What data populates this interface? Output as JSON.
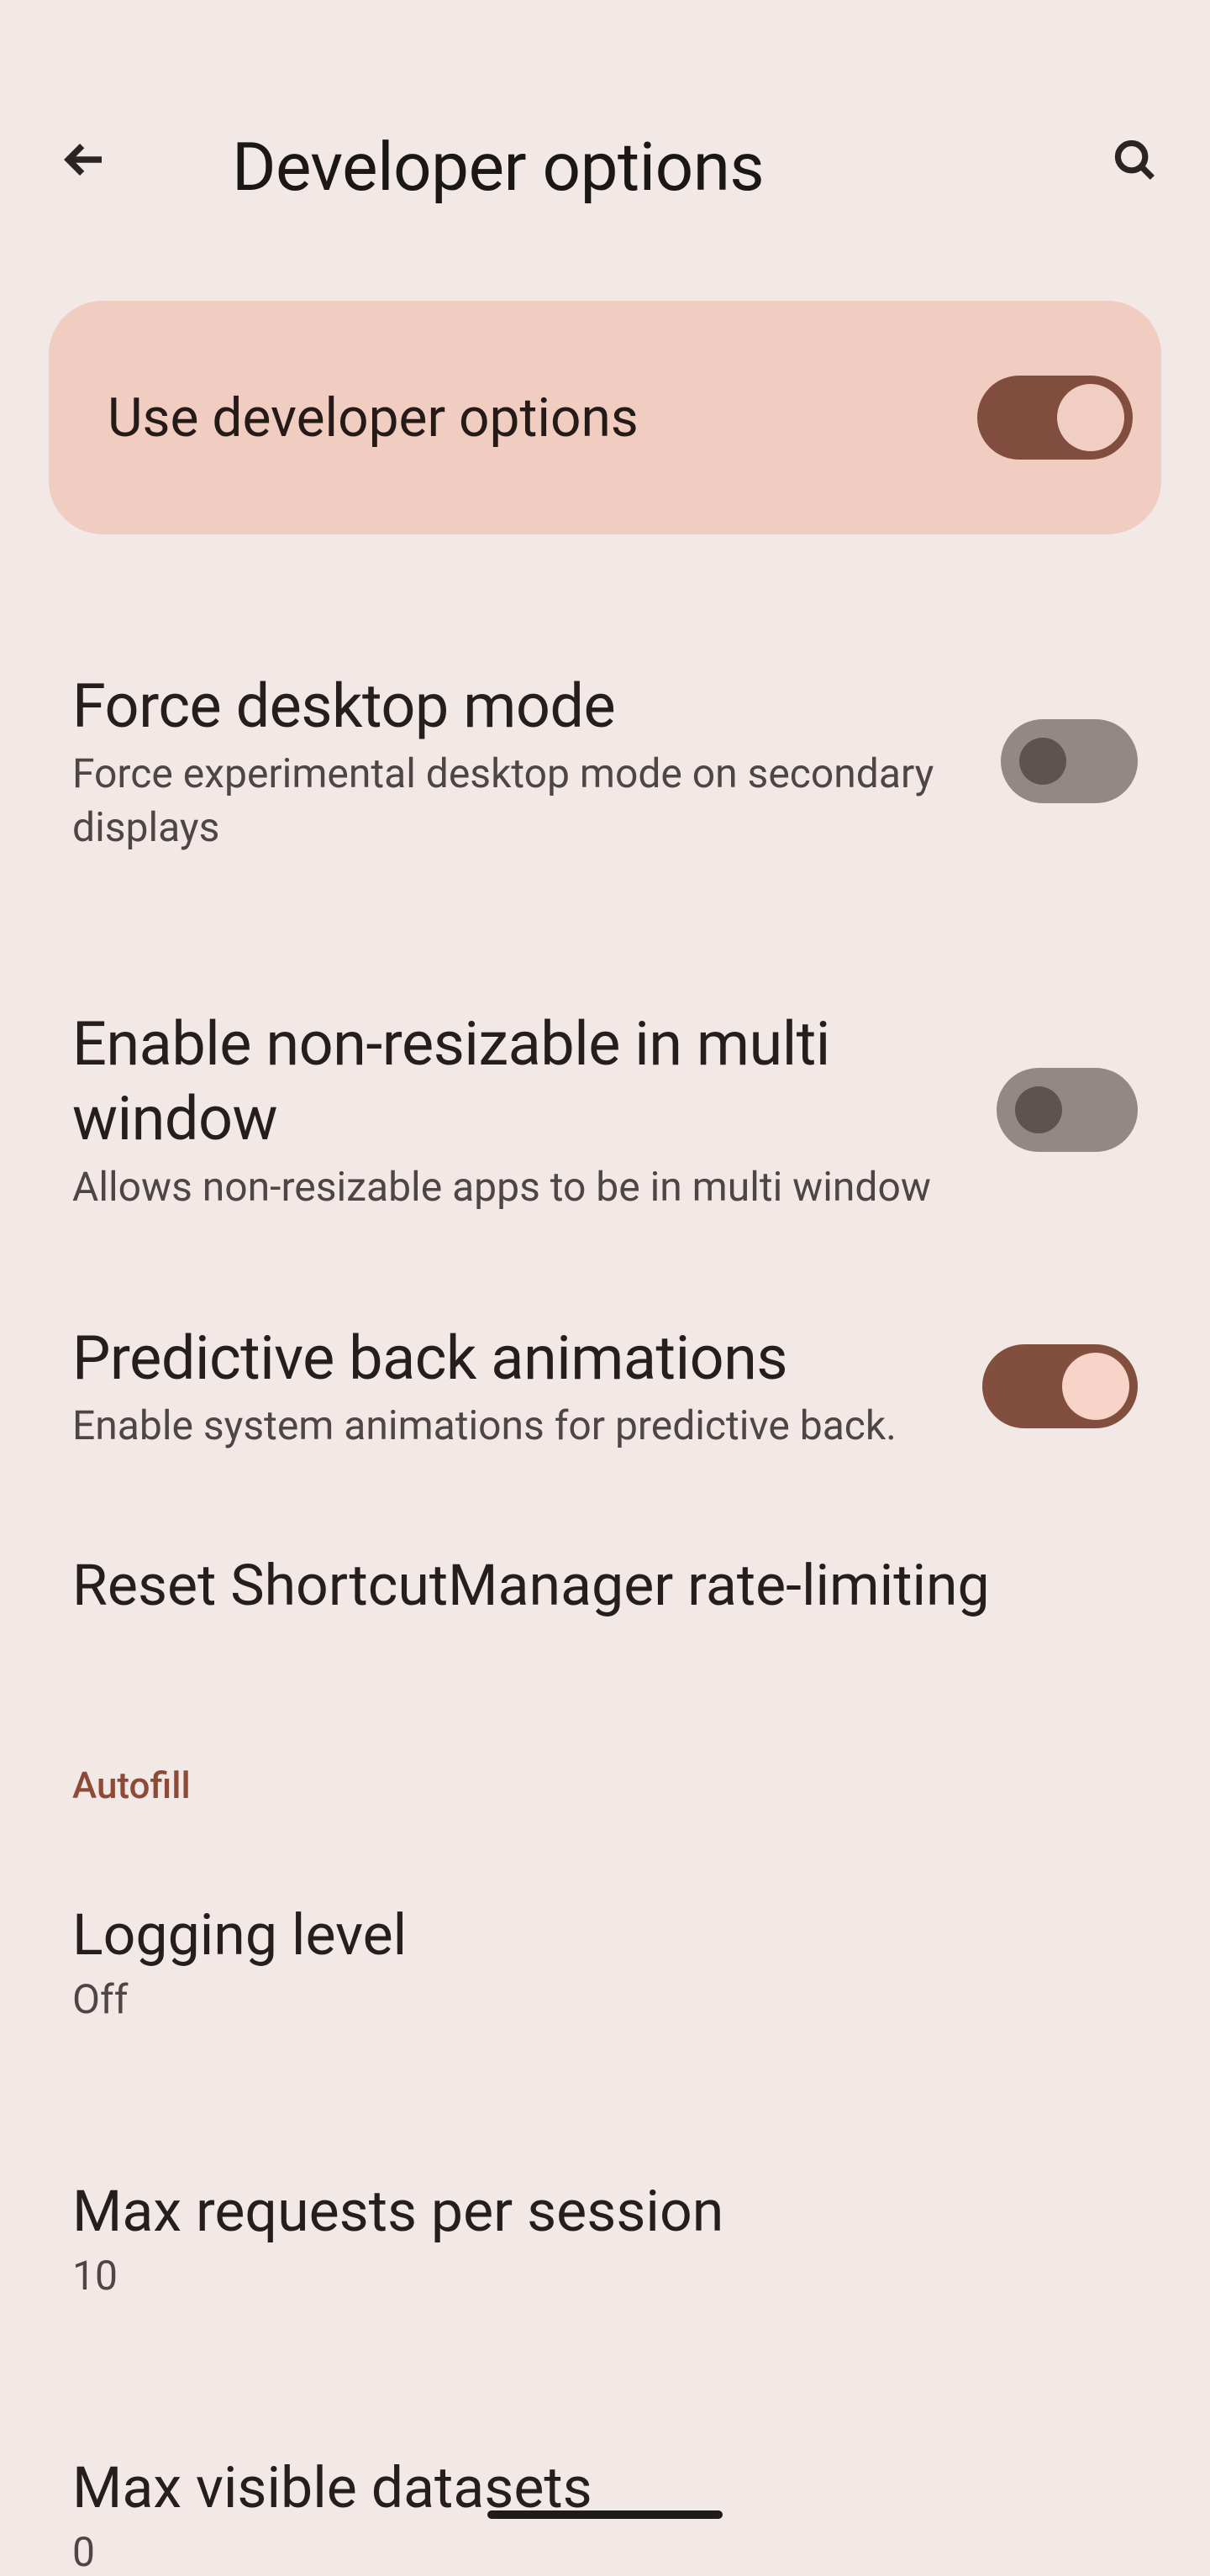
{
  "header": {
    "title": "Developer options"
  },
  "master": {
    "label": "Use developer options",
    "state": "on"
  },
  "settings": [
    {
      "title": "Force desktop mode",
      "desc": "Force experimental desktop mode on secondary displays",
      "state": "off"
    },
    {
      "title": "Enable non-resizable in multi window",
      "desc": "Allows non-resizable apps to be in multi window",
      "state": "off"
    },
    {
      "title": "Predictive back animations",
      "desc": "Enable system animations for predictive back.",
      "state": "on"
    }
  ],
  "reset_row": {
    "title": "Reset ShortcutManager rate-limiting"
  },
  "section": {
    "label": "Autofill"
  },
  "value_rows": [
    {
      "title": "Logging level",
      "value": "Off"
    },
    {
      "title": "Max requests per session",
      "value": "10"
    },
    {
      "title": "Max visible datasets",
      "value": "0"
    }
  ]
}
